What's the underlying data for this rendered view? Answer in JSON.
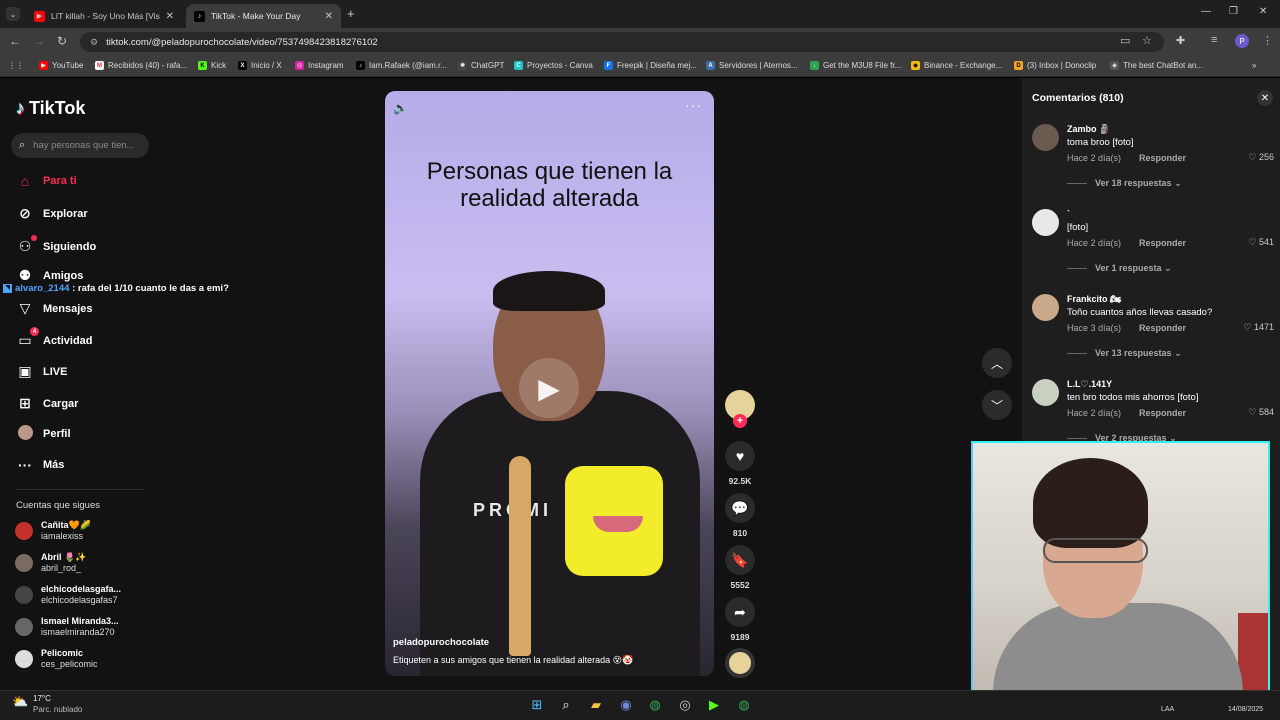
{
  "browser": {
    "tabs": [
      {
        "title": "LIT killah - Soy Uno Más [Visual",
        "active": false
      },
      {
        "title": "TikTok - Make Your Day",
        "active": true
      }
    ],
    "url": "tiktok.com/@peladopurochocolate/video/7537498423818276102",
    "bookmarks": [
      "YouTube",
      "Recibidos (40) - rafa...",
      "Kick",
      "Inicio / X",
      "Instagram",
      "Iam.Rafaek (@iam.r...",
      "ChatGPT",
      "Proyectos - Canva",
      "Freepik | Diseña mej...",
      "Servidores | Aternos...",
      "Get the M3U8 File fr...",
      "Binance - Exchange...",
      "(3) Inbox | Donoclip",
      "The best ChatBot an..."
    ],
    "profile_initial": "P"
  },
  "tiktok": {
    "logo": "TikTok",
    "search_placeholder": "hay personas que tien...",
    "nav": [
      {
        "label": "Para ti",
        "icon": "home-icon",
        "active": true
      },
      {
        "label": "Explorar",
        "icon": "compass-icon"
      },
      {
        "label": "Siguiendo",
        "icon": "following-icon"
      },
      {
        "label": "Amigos",
        "icon": "friends-icon"
      },
      {
        "label": "Mensajes",
        "icon": "messages-icon"
      },
      {
        "label": "Actividad",
        "icon": "activity-icon",
        "badge": "4"
      },
      {
        "label": "LIVE",
        "icon": "live-icon"
      },
      {
        "label": "Cargar",
        "icon": "upload-icon"
      },
      {
        "label": "Perfil",
        "icon": "profile-icon"
      },
      {
        "label": "Más",
        "icon": "more-icon"
      }
    ],
    "chat_overlay": {
      "user": "alvaro_2144",
      "message": ": rafa del 1/10 cuanto le das a emi?"
    },
    "following_title": "Cuentas que sigues",
    "following": [
      {
        "name": "Cañita🧡🌽",
        "handle": "iamalexiss",
        "color": "#c4302b"
      },
      {
        "name": "Abril 🌷✨",
        "handle": "abril_rod_",
        "color": "#7a6a60"
      },
      {
        "name": "elchicodelasgafa...",
        "handle": "elchicodelasgafas7",
        "color": "#444"
      },
      {
        "name": "Ismael Miranda3...",
        "handle": "ismaelmiranda270",
        "color": "#666"
      },
      {
        "name": "Pelicomic",
        "handle": "ces_pelicomic",
        "color": "#ddd"
      }
    ],
    "video": {
      "title": "Personas que tienen la realidad alterada",
      "shirt_text": "PROMI",
      "username": "peladopurochocolate",
      "caption": "Etiqueten a sus amigos que tienen la realidad alterada 😵🤡"
    },
    "actions": {
      "likes": "92.5K",
      "comments": "810",
      "saves": "5552",
      "shares": "9189"
    },
    "comments_panel": {
      "title": "Comentarios (810)",
      "items": [
        {
          "user": "Zambo 🗿",
          "text": "toma broo [foto]",
          "date": "Hace 2 día(s)",
          "reply": "Responder",
          "likes": "256",
          "more": "Ver 18 respuestas",
          "color": "#6b5a50"
        },
        {
          "user": "`",
          "text": "[foto]",
          "date": "Hace 2 día(s)",
          "reply": "Responder",
          "likes": "541",
          "more": "Ver 1 respuesta",
          "color": "#e8e8e8"
        },
        {
          "user": "Frankcito 🏍",
          "text": "Toño cuantos años llevas casado?",
          "date": "Hace 3 día(s)",
          "reply": "Responder",
          "likes": "1471",
          "more": "Ver 13 respuestas",
          "color": "#c9a98a"
        },
        {
          "user": "L.L♡.141Y",
          "text": "ten bro todos mis ahorros [foto]",
          "date": "Hace 2 día(s)",
          "reply": "Responder",
          "likes": "584",
          "more": "Ver 2 respuestas",
          "color": "#c8d0c0"
        }
      ]
    }
  },
  "taskbar": {
    "temp": "17°C",
    "weather": "Parc. nublado",
    "lang": "LAA",
    "date": "14/08/2025"
  }
}
